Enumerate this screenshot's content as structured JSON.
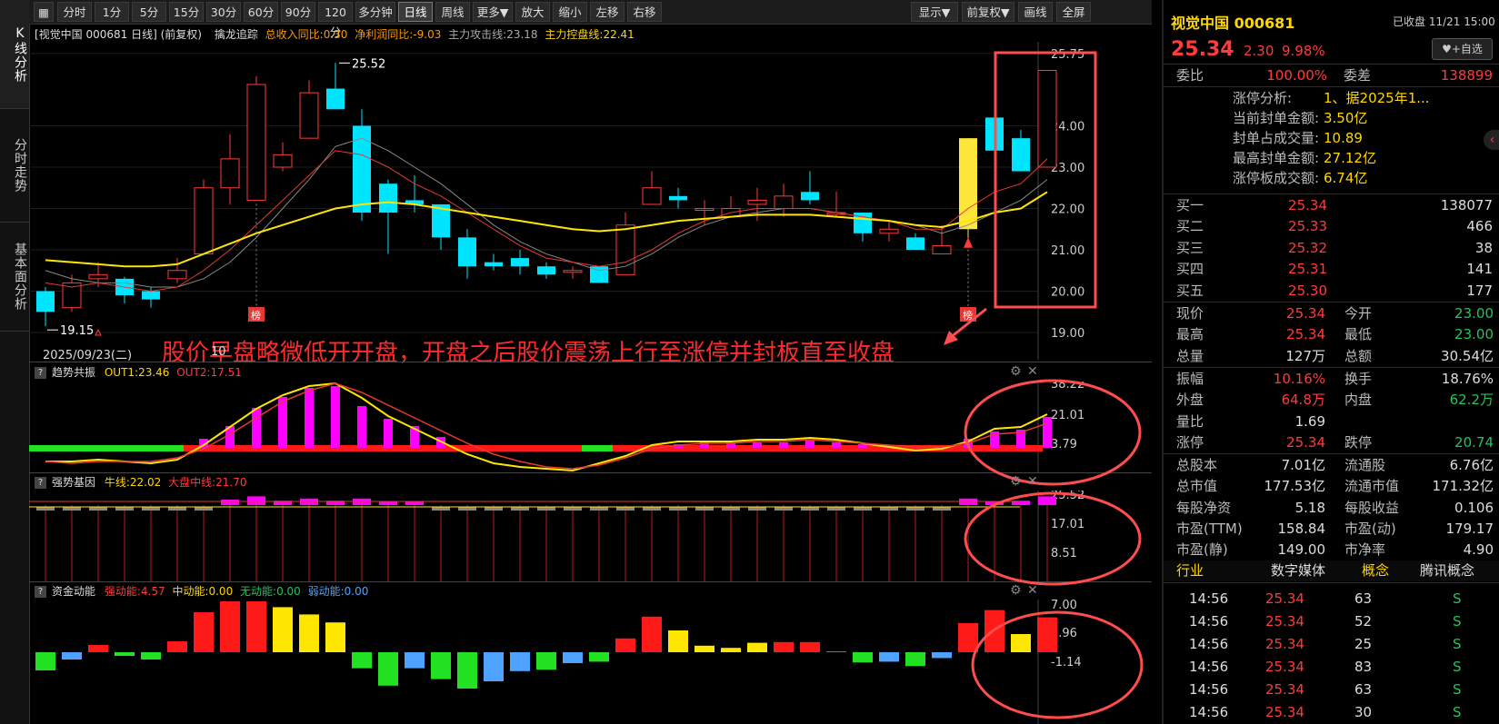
{
  "toolbar": {
    "buttons": [
      "分时",
      "1分",
      "5分",
      "15分",
      "30分",
      "60分",
      "90分",
      "120分",
      "多分钟",
      "日线",
      "周线",
      "更多▼",
      "放大",
      "缩小",
      "左移",
      "右移"
    ],
    "right_buttons": [
      "显示▼",
      "前复权▼",
      "画线",
      "全屏"
    ]
  },
  "left_tabs": [
    "K线分析",
    "分时走势",
    "基本面分析"
  ],
  "chart_header": {
    "title": "[视觉中国 000681 日线] (前复权)",
    "indicator_name": "擒龙追踪",
    "ind1": "总收入同比:0.30",
    "ind2": "净利润同比:-9.03",
    "ind3": "主力攻击线:23.18",
    "ind4": "主力控盘线:22.41"
  },
  "annotation": "股价早盘略微低开开盘，开盘之后股价震荡上行至涨停并封板直至收盘",
  "date_label": "2025/09/23(二)",
  "date_tick": "10",
  "marker_label": "榜",
  "sub1": {
    "name": "趋势共振",
    "out1": "OUT1:23.46",
    "out2": "OUT2:17.51",
    "ticks": [
      "38.22",
      "21.01",
      "3.79"
    ]
  },
  "sub2": {
    "name": "强势基因",
    "a": "牛线:22.02",
    "b": "大盘中线:21.70",
    "ticks": [
      "25.52",
      "17.01",
      "8.51"
    ]
  },
  "sub3": {
    "name": "资金动能",
    "a": "强动能:4.57",
    "b": "中动能:0.00",
    "c": "无动能:0.00",
    "d": "弱动能:0.00",
    "ticks": [
      "7.00",
      "2.96",
      "-1.14"
    ]
  },
  "chart_data": {
    "type": "candlestick",
    "price_ticks": [
      "25.75",
      "24.00",
      "23.00",
      "22.00",
      "21.00",
      "20.00",
      "19.00"
    ],
    "high_label": "25.52",
    "low_label": "19.15",
    "ohlc": [
      [
        20.0,
        19.5,
        20.1,
        19.15
      ],
      [
        19.6,
        20.2,
        20.4,
        19.5
      ],
      [
        20.3,
        20.4,
        20.7,
        20.1
      ],
      [
        20.3,
        19.9,
        20.35,
        19.7
      ],
      [
        20.0,
        19.8,
        20.1,
        19.6
      ],
      [
        20.3,
        20.5,
        20.8,
        20.2
      ],
      [
        20.9,
        22.5,
        22.7,
        20.9
      ],
      [
        22.5,
        23.2,
        23.8,
        22.1
      ],
      [
        22.2,
        25.0,
        25.2,
        22.2
      ],
      [
        23.0,
        23.3,
        23.6,
        22.9
      ],
      [
        23.7,
        24.8,
        25.1,
        23.7
      ],
      [
        24.9,
        24.4,
        25.52,
        24.4
      ],
      [
        24.0,
        21.9,
        24.4,
        21.7
      ],
      [
        22.6,
        21.9,
        22.7,
        20.9
      ],
      [
        22.2,
        22.1,
        22.8,
        21.9
      ],
      [
        22.1,
        21.3,
        22.1,
        21.0
      ],
      [
        21.3,
        20.6,
        21.5,
        20.3
      ],
      [
        20.7,
        20.6,
        20.9,
        20.5
      ],
      [
        20.8,
        20.6,
        21.0,
        20.4
      ],
      [
        20.6,
        20.4,
        20.7,
        20.3
      ],
      [
        20.5,
        20.5,
        20.6,
        20.3
      ],
      [
        20.6,
        20.2,
        20.6,
        20.2
      ],
      [
        20.4,
        21.6,
        21.9,
        20.4
      ],
      [
        22.1,
        22.5,
        22.9,
        22.1
      ],
      [
        22.3,
        22.2,
        22.5,
        22.0
      ],
      [
        22.0,
        22.0,
        22.2,
        21.6
      ],
      [
        21.8,
        22.0,
        22.3,
        21.8
      ],
      [
        22.1,
        22.2,
        22.5,
        21.7
      ],
      [
        22.0,
        22.3,
        22.6,
        21.8
      ],
      [
        22.4,
        22.2,
        22.9,
        22.1
      ],
      [
        21.9,
        21.9,
        22.4,
        21.8
      ],
      [
        21.9,
        21.4,
        21.9,
        21.2
      ],
      [
        21.4,
        21.5,
        21.7,
        21.2
      ],
      [
        21.3,
        21.0,
        21.4,
        21.0
      ],
      [
        20.9,
        21.1,
        21.6,
        20.9
      ],
      [
        21.5,
        23.7,
        23.7,
        21.2
      ],
      [
        24.2,
        23.4,
        24.5,
        23.4
      ],
      [
        23.7,
        22.9,
        23.9,
        22.9
      ],
      [
        23.0,
        25.34,
        25.34,
        23.0
      ]
    ],
    "ma_yellow": [
      20.75,
      20.7,
      20.65,
      20.6,
      20.6,
      20.65,
      20.9,
      21.15,
      21.4,
      21.6,
      21.8,
      22.0,
      22.1,
      22.15,
      22.1,
      22.0,
      21.9,
      21.8,
      21.7,
      21.6,
      21.5,
      21.45,
      21.5,
      21.6,
      21.7,
      21.75,
      21.8,
      21.85,
      21.85,
      21.85,
      21.8,
      21.75,
      21.7,
      21.6,
      21.55,
      21.7,
      21.9,
      22.0,
      22.4
    ],
    "ma_red": [
      20.2,
      20.1,
      20.2,
      20.1,
      20.0,
      20.1,
      20.5,
      21.0,
      21.6,
      22.2,
      22.8,
      23.4,
      23.3,
      23.0,
      22.6,
      22.3,
      21.9,
      21.5,
      21.1,
      20.8,
      20.7,
      20.6,
      20.7,
      21.0,
      21.4,
      21.7,
      21.9,
      22.0,
      22.0,
      22.0,
      21.9,
      21.8,
      21.7,
      21.5,
      21.5,
      22.0,
      22.4,
      22.6,
      23.2
    ],
    "ma_gray": [
      20.5,
      20.3,
      20.2,
      20.2,
      20.1,
      20.1,
      20.3,
      20.7,
      21.3,
      22.0,
      22.7,
      23.5,
      23.7,
      23.4,
      23.0,
      22.6,
      22.1,
      21.6,
      21.2,
      20.9,
      20.7,
      20.5,
      20.6,
      20.9,
      21.3,
      21.6,
      21.8,
      21.9,
      22.0,
      22.0,
      21.9,
      21.8,
      21.7,
      21.6,
      21.4,
      21.6,
      21.9,
      22.2,
      22.7
    ]
  },
  "trend_bars": [
    0,
    0,
    0,
    0,
    0,
    0,
    0.5,
    1.2,
    2.2,
    2.8,
    3.3,
    3.4,
    2.3,
    1.6,
    1.2,
    0.6,
    0,
    0,
    0,
    0,
    0,
    0,
    0,
    0,
    0.2,
    0.3,
    0.3,
    0.3,
    0.3,
    0.4,
    0.3,
    0.2,
    0.1,
    0,
    0,
    0.5,
    0.9,
    1.0,
    1.7
  ],
  "gene_bars": [
    -0.3,
    -0.3,
    -0.4,
    -0.3,
    -0.3,
    -0.3,
    -0.2,
    0.5,
    0.8,
    0.4,
    0.6,
    0.4,
    0.6,
    0.3,
    0.3,
    -0.3,
    -0.4,
    -0.3,
    -0.3,
    -0.3,
    -0.3,
    -0.4,
    -0.4,
    -0.3,
    -0.2,
    -0.3,
    -0.3,
    -0.2,
    -0.3,
    -0.3,
    -0.2,
    -0.3,
    -0.3,
    -0.3,
    -0.3,
    0.6,
    0.3,
    0.4,
    0.8
  ],
  "flow_bars": [
    [
      -2.5,
      "g"
    ],
    [
      -1.0,
      "b"
    ],
    [
      1.0,
      "r"
    ],
    [
      -0.5,
      "g"
    ],
    [
      -1.0,
      "g"
    ],
    [
      1.5,
      "r"
    ],
    [
      5.5,
      "r"
    ],
    [
      7.0,
      "r"
    ],
    [
      7.0,
      "r"
    ],
    [
      6.2,
      "y"
    ],
    [
      5.2,
      "y"
    ],
    [
      4.1,
      "y"
    ],
    [
      -2.2,
      "g"
    ],
    [
      -4.6,
      "g"
    ],
    [
      -2.2,
      "b"
    ],
    [
      -3.7,
      "g"
    ],
    [
      -5.0,
      "g"
    ],
    [
      -4.0,
      "b"
    ],
    [
      -2.6,
      "b"
    ],
    [
      -2.4,
      "g"
    ],
    [
      -1.5,
      "b"
    ],
    [
      -1.3,
      "g"
    ],
    [
      1.9,
      "r"
    ],
    [
      4.9,
      "r"
    ],
    [
      3.0,
      "y"
    ],
    [
      0.9,
      "y"
    ],
    [
      0.6,
      "y"
    ],
    [
      1.3,
      "y"
    ],
    [
      1.4,
      "r"
    ],
    [
      1.4,
      "r"
    ],
    [
      0.1,
      "g"
    ],
    [
      -1.4,
      "g"
    ],
    [
      -1.3,
      "b"
    ],
    [
      -1.9,
      "g"
    ],
    [
      -0.8,
      "b"
    ],
    [
      4.0,
      "r"
    ],
    [
      5.8,
      "r"
    ],
    [
      2.5,
      "y"
    ],
    [
      4.8,
      "r"
    ]
  ],
  "quote": {
    "title": "视觉中国 000681",
    "status": "已收盘 11/21 15:00",
    "price": "25.34",
    "change": "2.30",
    "pct": "9.98%",
    "fav": "♥+自选",
    "weibi_l": "委比",
    "weibi": "100.00%",
    "weicha_l": "委差",
    "weicha": "138899",
    "limit_rows": [
      [
        "涨停分析:",
        "1、据2025年1..."
      ],
      [
        "当前封单金额:",
        "3.50亿"
      ],
      [
        "封单占成交量:",
        "10.89"
      ],
      [
        "最高封单金额:",
        "27.12亿"
      ],
      [
        "涨停板成交额:",
        "6.74亿"
      ]
    ],
    "bids": [
      [
        "买一",
        "25.34",
        "138077"
      ],
      [
        "买二",
        "25.33",
        "466"
      ],
      [
        "买三",
        "25.32",
        "38"
      ],
      [
        "买四",
        "25.31",
        "141"
      ],
      [
        "买五",
        "25.30",
        "177"
      ]
    ],
    "stats": [
      [
        [
          "现价",
          "25.34",
          "r"
        ],
        [
          "今开",
          "23.00",
          "g"
        ]
      ],
      [
        [
          "最高",
          "25.34",
          "r"
        ],
        [
          "最低",
          "23.00",
          "g"
        ]
      ],
      [
        [
          "总量",
          "127万",
          "w"
        ],
        [
          "总额",
          "30.54亿",
          "w"
        ]
      ],
      [
        [
          "振幅",
          "10.16%",
          "r"
        ],
        [
          "换手",
          "18.76%",
          "w"
        ]
      ],
      [
        [
          "外盘",
          "64.8万",
          "r"
        ],
        [
          "内盘",
          "62.2万",
          "g"
        ]
      ],
      [
        [
          "量比",
          "1.69",
          "w"
        ],
        [
          "",
          "",
          " "
        ]
      ],
      [
        [
          "涨停",
          "25.34",
          "r"
        ],
        [
          "跌停",
          "20.74",
          "g"
        ]
      ],
      [
        [
          "总股本",
          "7.01亿",
          "w"
        ],
        [
          "流通股",
          "6.76亿",
          "w"
        ]
      ],
      [
        [
          "总市值",
          "177.53亿",
          "w"
        ],
        [
          "流通市值",
          "171.32亿",
          "w"
        ]
      ],
      [
        [
          "每股净资",
          "5.18",
          "w"
        ],
        [
          "每股收益",
          "0.106",
          "w"
        ]
      ],
      [
        [
          "市盈(TTM)",
          "158.84",
          "w"
        ],
        [
          "市盈(动)",
          "179.17",
          "w"
        ]
      ],
      [
        [
          "市盈(静)",
          "149.00",
          "w"
        ],
        [
          "市净率",
          "4.90",
          "w"
        ]
      ]
    ],
    "industry": [
      "行业",
      "数字媒体",
      "概念",
      "腾讯概念"
    ],
    "ticks": [
      [
        "14:56",
        "25.34",
        "63",
        "S"
      ],
      [
        "14:56",
        "25.34",
        "52",
        "S"
      ],
      [
        "14:56",
        "25.34",
        "25",
        "S"
      ],
      [
        "14:56",
        "25.34",
        "83",
        "S"
      ],
      [
        "14:56",
        "25.34",
        "63",
        "S"
      ],
      [
        "14:56",
        "25.34",
        "30",
        "S"
      ]
    ]
  }
}
